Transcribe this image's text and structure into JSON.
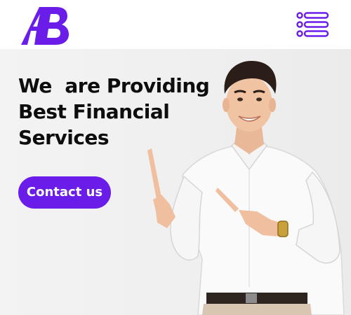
{
  "brand": {
    "logo_text": "AB",
    "accent": "#6a1de8"
  },
  "header": {
    "menu_icon": "hamburger-menu-icon"
  },
  "hero": {
    "headline_lines": [
      "We  are Providing",
      "Best Financial",
      "Services"
    ],
    "cta_label": "Contact us",
    "image": "smiling-man-pointing-left"
  }
}
